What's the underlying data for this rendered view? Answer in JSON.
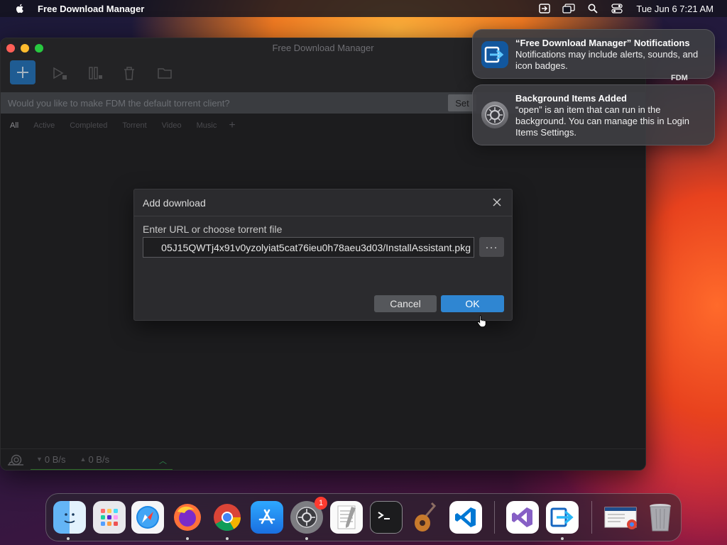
{
  "menubar": {
    "app_name": "Free Download Manager",
    "clock": "Tue Jun 6  7:21 AM",
    "icons": [
      "apple-icon",
      "fdm-menu-icon",
      "screen-mirroring-icon",
      "spotlight-search-icon",
      "control-center-icon"
    ]
  },
  "window": {
    "title": "Free Download Manager",
    "banner_text": "Would you like to make FDM the default torrent client?",
    "banner_button": "Set",
    "filters": [
      "All",
      "Active",
      "Completed",
      "Torrent",
      "Video",
      "Music"
    ],
    "filter_add": "+",
    "status": {
      "download_speed": "0 B/s",
      "upload_speed": "0 B/s"
    }
  },
  "dialog": {
    "title": "Add download",
    "label": "Enter URL or choose torrent file",
    "url_value": "05J15QWTj4x91v0yzolyiat5cat76ieu0h78aeu3d03/InstallAssistant.pkg",
    "browse_label": "···",
    "cancel_label": "Cancel",
    "ok_label": "OK"
  },
  "notifications": [
    {
      "title": "“Free Download Manager” Notifications",
      "body": "Notifications may include alerts, sounds, and icon badges."
    },
    {
      "title": "Background Items Added",
      "body": "“open” is an item that can run in the background. You can manage this in Login Items Settings."
    }
  ],
  "notification_peek_label": "FDM",
  "dock": {
    "badge_count": "1",
    "items": [
      "finder",
      "launchpad",
      "safari",
      "firefox",
      "chrome",
      "app-store",
      "system-settings",
      "textedit",
      "terminal",
      "garageband",
      "vscode",
      "visual-studio",
      "free-download-manager",
      "downloads-stack",
      "trash"
    ]
  }
}
